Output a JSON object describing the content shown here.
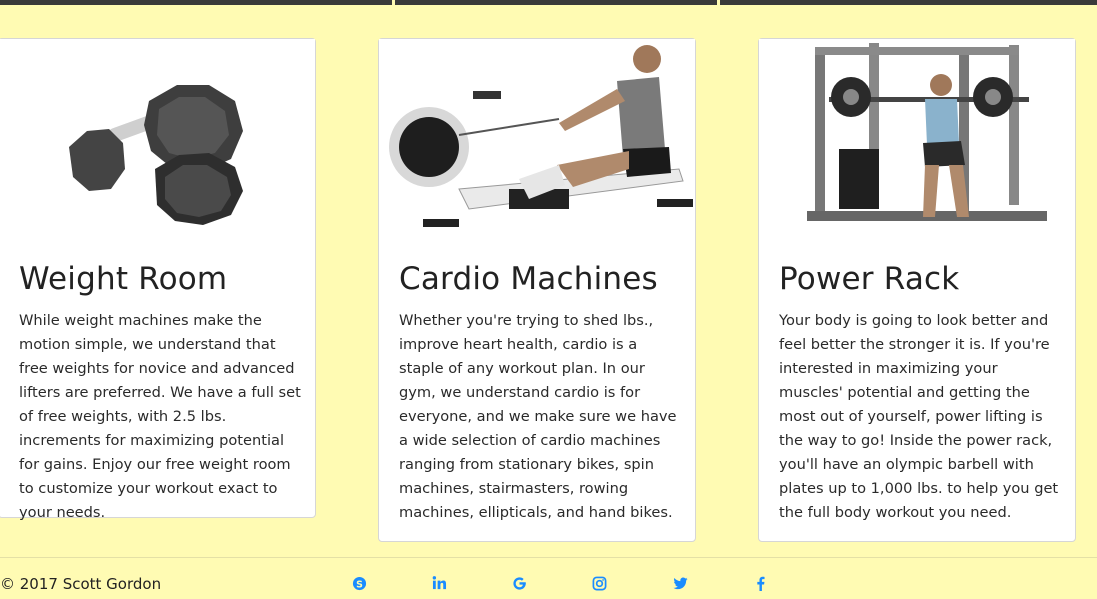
{
  "cards": [
    {
      "title": "Weight Room",
      "text": "While weight machines make the motion simple, we understand that free weights for novice and advanced lifters are preferred. We have a full set of free weights, with 2.5 lbs. increments for maximizing potential for gains. Enjoy our free weight room to customize your workout exact to your needs."
    },
    {
      "title": "Cardio Machines",
      "text": "Whether you're trying to shed lbs., improve heart health, cardio is a staple of any workout plan. In our gym, we understand cardio is for everyone, and we make sure we have a wide selection of cardio machines ranging from stationary bikes, spin machines, stairmasters, rowing machines, ellipticals, and hand bikes."
    },
    {
      "title": "Power Rack",
      "text": "Your body is going to look better and feel better the stronger it is. If you're interested in maximizing your muscles' potential and getting the most out of yourself, power lifting is the way to go! Inside the power rack, you'll have an olympic barbell with plates up to 1,000 lbs. to help you get the full body workout you need."
    }
  ],
  "footer": {
    "copyright": "© 2017 Scott Gordon",
    "social_icons": [
      "skype-icon",
      "linkedin-icon",
      "google-icon",
      "instagram-icon",
      "twitter-icon",
      "facebook-icon"
    ],
    "icon_color": "#1a8cff"
  }
}
